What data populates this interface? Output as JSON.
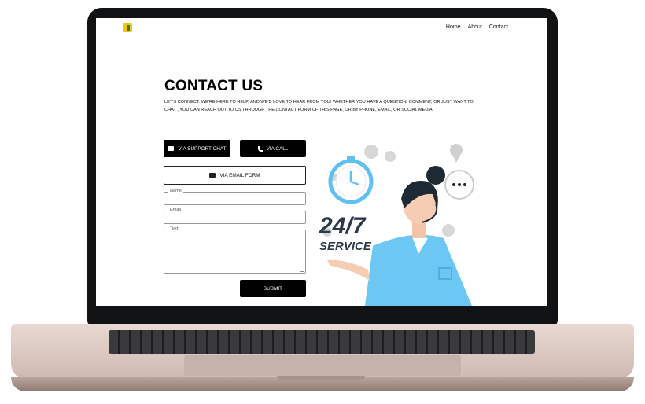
{
  "nav": {
    "items": [
      "Home",
      "About",
      "Contact"
    ]
  },
  "hero": {
    "title": "CONTACT US",
    "description": "LET'S CONNECT: WE'RE HERE TO HELP, AND WE'D LOVE TO HEAR FROM YOU! WHETHER YOU HAVE A QUESTION, COMMENT, OR JUST WANT TO CHAT , YOU CAN REACH OUT TO US THROUGH THE CONTACT FORM OF THIS PAGE, OR BY PHONE, EMAIL, OR SOCIAL MEDIA."
  },
  "buttons": {
    "support_chat": "VIA SUPPORT CHAT",
    "call": "VIA CALL",
    "email_form": "VIA EMAIL FORM",
    "submit": "SUBMIT"
  },
  "form": {
    "name_label": "Name",
    "email_label": "Email",
    "text_label": "Text"
  },
  "illustration": {
    "badge_line1": "24/7",
    "badge_line2": "SERVICE"
  },
  "colors": {
    "accent_blue": "#5ec1f2",
    "dark": "#000000",
    "logo_yellow": "#f3c318"
  }
}
